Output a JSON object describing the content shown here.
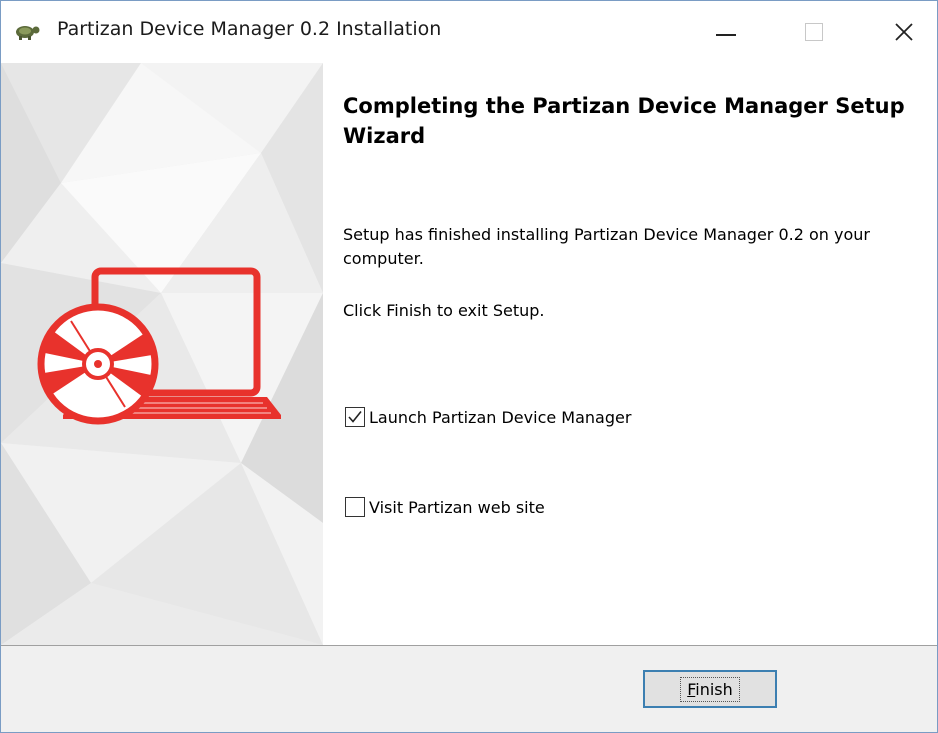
{
  "window": {
    "title": "Partizan Device Manager 0.2 Installation"
  },
  "content": {
    "heading": "Completing the Partizan Device Manager Setup Wizard",
    "paragraph_finished": "Setup has finished installing Partizan Device Manager 0.2 on your computer.",
    "paragraph_exit": "Click Finish to exit Setup.",
    "options": [
      {
        "label": "Launch Partizan Device Manager",
        "checked": true
      },
      {
        "label": "Visit Partizan web site",
        "checked": false
      }
    ]
  },
  "footer": {
    "finish_label_first": "F",
    "finish_label_rest": "inish"
  },
  "colors": {
    "accent_red": "#e8322c",
    "button_focus_border": "#3c7fb1"
  },
  "icons": [
    "app-icon",
    "minimize-icon",
    "maximize-icon",
    "close-icon",
    "laptop-disc-icon",
    "checkmark-icon"
  ]
}
